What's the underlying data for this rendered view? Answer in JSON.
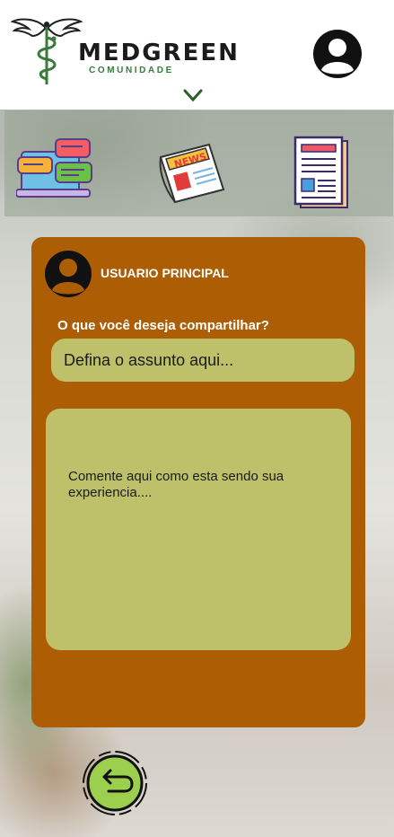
{
  "header": {
    "brand_name": "MEDGREEN",
    "brand_sub": "COMUNIDADE",
    "logo_icon": "caduceus-icon",
    "profile_icon": "user-avatar-icon",
    "menu_icon": "chevron-down-icon"
  },
  "nav": {
    "items": [
      {
        "icon": "chat-bubbles-icon"
      },
      {
        "icon": "newspaper-icon",
        "label": "NEWS"
      },
      {
        "icon": "document-icon"
      }
    ]
  },
  "post": {
    "username": "USUARIO PRINCIPAL",
    "question": "O que você deseja compartilhar?",
    "subject_placeholder": "Defina o assunto aqui...",
    "comment_placeholder": "Comente aqui como esta sendo sua experiencia...."
  },
  "footer": {
    "back_icon": "back-arrow-icon"
  },
  "colors": {
    "card": "#ad5e05",
    "field": "#bec169",
    "back_button": "#9ccf4e",
    "brand_green": "#3a7a3c"
  }
}
